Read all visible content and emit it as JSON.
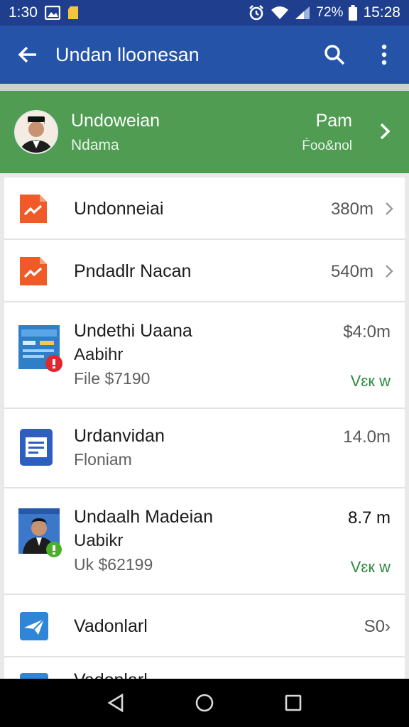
{
  "status_bar": {
    "time_left": "1:30",
    "battery_percent": "72%",
    "time_right": "15:28",
    "icons": [
      "photo-icon",
      "sd-card-icon",
      "alarm-icon",
      "wifi-icon",
      "signal-icon",
      "battery-icon"
    ]
  },
  "app_bar": {
    "title": "Undan lloonesan",
    "icons": [
      "back-arrow-icon",
      "search-icon",
      "more-vert-icon"
    ]
  },
  "account": {
    "name": "Undoweian",
    "subtitle": "Ndama",
    "plan": "Pam",
    "plan_sub": "Ḟoo&nol"
  },
  "files": [
    {
      "title": "Undonneiai",
      "size": "380m",
      "icon": "pdf-icon",
      "color": "#f05a28"
    },
    {
      "title": "Pndadlr Nacan",
      "size": "540m",
      "icon": "pdf-icon",
      "color": "#f05a28"
    },
    {
      "title": "Undethi Uaana",
      "line2": "Aabihr",
      "sub": "File  $7190",
      "size": "$4:0m",
      "link": "Vɛк w",
      "icon": "screenshot-thumbnail-icon",
      "badge_color": "#e0262f"
    },
    {
      "title": "Urdanvidan",
      "sub": "Floniam",
      "size": "14.0m",
      "icon": "doc-icon",
      "color": "#2c5fbf"
    },
    {
      "title": "Undaalh Madeian",
      "line2": "Uabikr",
      "sub": "Uk $62199",
      "size": "8.7 m",
      "link": "Vɛк w",
      "icon": "person-thumbnail-icon",
      "badge_color": "#4caf2a"
    },
    {
      "title": "Vadonlarl",
      "size": "S0›",
      "icon": "send-icon",
      "color": "#2f86d6"
    },
    {
      "title": "Vadonlarl",
      "icon": "doc-icon",
      "color": "#2f86d6"
    }
  ],
  "nav_bar": {
    "icons": [
      "back-triangle-icon",
      "home-circle-icon",
      "recents-square-icon"
    ]
  }
}
